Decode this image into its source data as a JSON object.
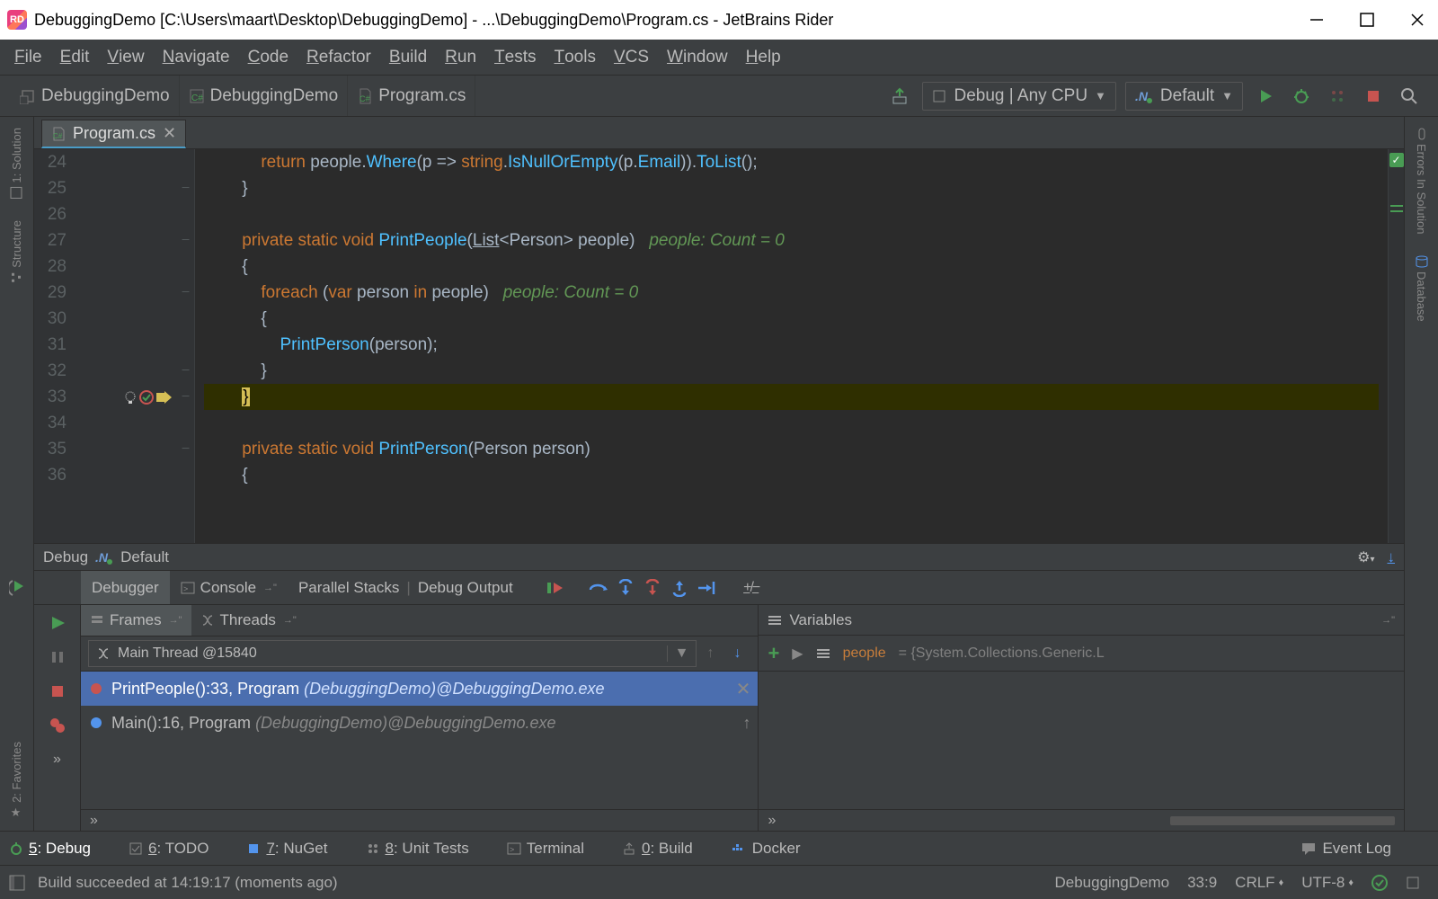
{
  "window": {
    "title": "DebuggingDemo [C:\\Users\\maart\\Desktop\\DebuggingDemo] - ...\\DebuggingDemo\\Program.cs - JetBrains Rider"
  },
  "menu": [
    "File",
    "Edit",
    "View",
    "Navigate",
    "Code",
    "Refactor",
    "Build",
    "Run",
    "Tests",
    "Tools",
    "VCS",
    "Window",
    "Help"
  ],
  "breadcrumbs": [
    "DebuggingDemo",
    "DebuggingDemo",
    "Program.cs"
  ],
  "toolbar": {
    "config": "Debug | Any CPU",
    "runconfig": "Default"
  },
  "editor_tab": "Program.cs",
  "line_numbers": [
    24,
    25,
    26,
    27,
    28,
    29,
    30,
    31,
    32,
    33,
    34,
    35,
    36
  ],
  "code": {
    "24": {
      "raw": "            return people.Where(p => string.IsNullOrEmpty(p.Email)).ToList();"
    },
    "25": {
      "raw": "        }"
    },
    "26": {
      "raw": ""
    },
    "27": {
      "sig": "private static void PrintPeople(List<Person> people)",
      "hint": "people: Count = 0"
    },
    "28": {
      "raw": "        {"
    },
    "29": {
      "sig": "foreach (var person in people)",
      "hint": "people: Count = 0"
    },
    "30": {
      "raw": "            {"
    },
    "31": {
      "raw": "                PrintPerson(person);"
    },
    "32": {
      "raw": "            }"
    },
    "33": {
      "raw": "}",
      "exec": true
    },
    "34": {
      "raw": ""
    },
    "35": {
      "sig": "private static void PrintPerson(Person person)"
    },
    "36": {
      "raw": "        {"
    }
  },
  "debug": {
    "title": "Debug",
    "config": "Default",
    "tabs": [
      "Debugger",
      "Console",
      "Parallel Stacks",
      "Debug Output"
    ],
    "subtabs": [
      "Frames",
      "Threads"
    ],
    "thread": "Main Thread @15840",
    "frames": [
      {
        "text": "PrintPeople():33, Program ",
        "ital": "(DebuggingDemo)@DebuggingDemo.exe",
        "selected": true,
        "color": "#c75450"
      },
      {
        "text": "Main():16, Program ",
        "ital": "(DebuggingDemo)@DebuggingDemo.exe",
        "selected": false,
        "color": "#5394ec"
      }
    ],
    "variables_header": "Variables",
    "variable": {
      "name": "people",
      "value": " = {System.Collections.Generic.L"
    }
  },
  "left_strip": [
    "1: Solution",
    "Structure"
  ],
  "left_strip_bottom": [
    "2: Favorites"
  ],
  "right_strip": [
    "Errors In Solution",
    "Database"
  ],
  "bottom_tools": [
    {
      "label": "5: Debug",
      "active": true
    },
    {
      "label": "6: TODO"
    },
    {
      "label": "7: NuGet"
    },
    {
      "label": "8: Unit Tests"
    },
    {
      "label": "Terminal"
    },
    {
      "label": "0: Build"
    },
    {
      "label": "Docker"
    }
  ],
  "bottom_right": "Event Log",
  "status": {
    "msg": "Build succeeded at 14:19:17 (moments ago)",
    "project": "DebuggingDemo",
    "pos": "33:9",
    "eol": "CRLF",
    "enc": "UTF-8"
  }
}
